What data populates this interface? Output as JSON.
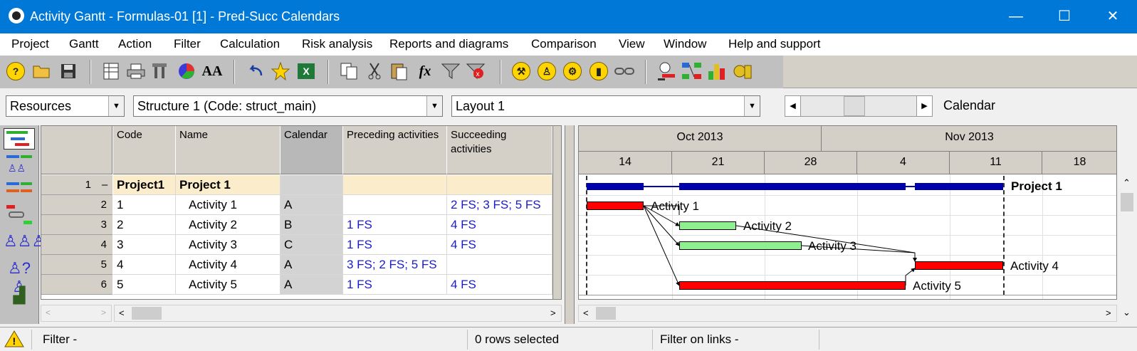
{
  "window": {
    "title": "Activity Gantt - Formulas-01 [1] - Pred-Succ Calendars",
    "minimize_glyph": "—",
    "maximize_glyph": "☐",
    "close_glyph": "✕"
  },
  "menu": [
    "Project",
    "Gantt",
    "Action",
    "Filter",
    "Calculation",
    "Risk analysis",
    "Reports and diagrams",
    "Comparison",
    "View",
    "Window",
    "Help and support"
  ],
  "toolbar": {
    "icons": [
      "help-icon",
      "open-folder-icon",
      "save-icon",
      "table-icon",
      "print-icon",
      "tools-icon",
      "pie-chart-icon",
      "font-icon",
      "undo-icon",
      "star-icon",
      "excel-icon",
      "copy-icon",
      "cut-icon",
      "paste-icon",
      "formula-icon",
      "filter-icon",
      "clear-filter-icon",
      "resource-run-icon",
      "resource-person-icon",
      "resource-tool-icon",
      "resource-material-icon",
      "link-icon",
      "schedule-icon",
      "network-icon",
      "histogram-icon",
      "cost-icon"
    ],
    "glyphs": {
      "help": "?",
      "formula": "fx",
      "font": "AA",
      "excel": "X"
    }
  },
  "combos": {
    "view": "Resources",
    "structure": "Structure 1 (Code: struct_main)",
    "layout": "Layout  1",
    "calendar_label": "Calendar"
  },
  "grid": {
    "columns": [
      "Code",
      "Name",
      "Calendar",
      "Preceding activities",
      "Succeeding activities"
    ],
    "rows": [
      {
        "num": "1",
        "collapse": "–",
        "code": "Project1",
        "name": "Project 1",
        "calendar": "",
        "pred": "",
        "succ": ""
      },
      {
        "num": "2",
        "code": "1",
        "name": "Activity 1",
        "calendar": "A",
        "pred": "",
        "succ": "2 FS; 3 FS; 5 FS"
      },
      {
        "num": "3",
        "code": "2",
        "name": "Activity 2",
        "calendar": "B",
        "pred": "1 FS",
        "succ": "4 FS"
      },
      {
        "num": "4",
        "code": "3",
        "name": "Activity 3",
        "calendar": "C",
        "pred": "1 FS",
        "succ": "4 FS"
      },
      {
        "num": "5",
        "code": "4",
        "name": "Activity 4",
        "calendar": "A",
        "pred": "3 FS; 2 FS; 5 FS",
        "succ": ""
      },
      {
        "num": "6",
        "code": "5",
        "name": "Activity 5",
        "calendar": "A",
        "pred": "1 FS",
        "succ": "4 FS"
      }
    ]
  },
  "gantt": {
    "months": [
      "Oct 2013",
      "Nov 2013"
    ],
    "days": [
      "14",
      "21",
      "28",
      "4",
      "11",
      "18"
    ],
    "labels": {
      "project": "Project 1",
      "a1": "Activity 1",
      "a2": "Activity 2",
      "a3": "Activity 3",
      "a4": "Activity 4",
      "a5": "Activity 5"
    },
    "colors": {
      "critical": "#ff0000",
      "normal": "#8ef08e",
      "summary": "#0000aa"
    }
  },
  "status": {
    "filter": "Filter -",
    "selected": "0 rows selected",
    "link_filter": "Filter on links -"
  }
}
